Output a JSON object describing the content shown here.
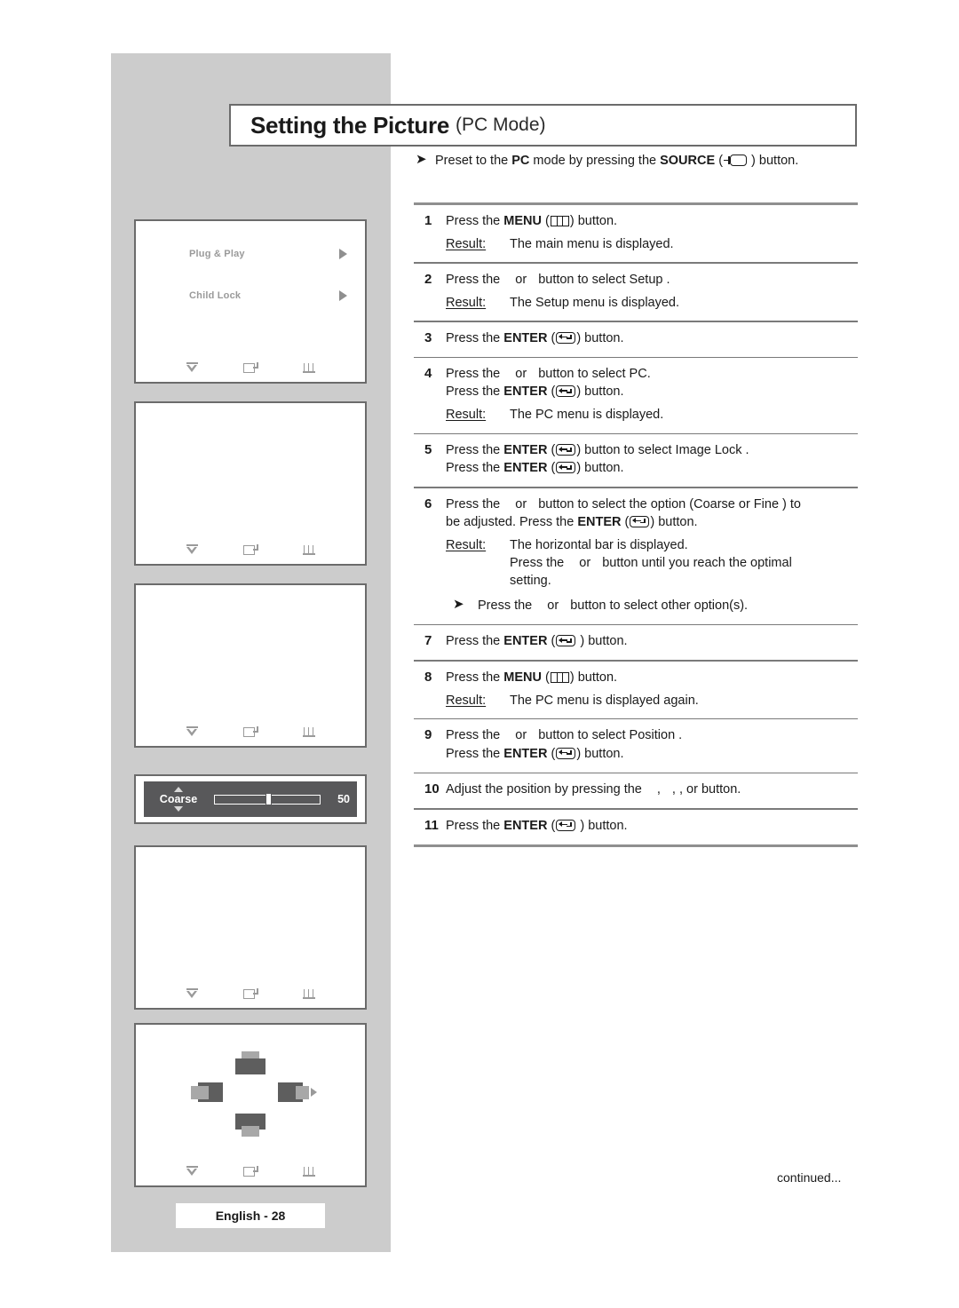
{
  "page": {
    "title_main": "Setting the Picture",
    "title_sub": "(PC Mode)",
    "continued_label": "continued...",
    "footer_label": "English - 28"
  },
  "intro": {
    "text_before_pc": "Preset to the ",
    "pc": "PC",
    "text_mid": " mode by pressing the ",
    "source": "SOURCE",
    "text_after": " ) button.",
    "open_paren": "(",
    "icon": "source-key-icon"
  },
  "steps": [
    {
      "num": "1",
      "lines": [
        {
          "pre": "Press the ",
          "bold": "MENU",
          "paren_open": "(",
          "icon": "menu-key-icon",
          "post": ") button."
        }
      ],
      "result": {
        "label": "Result:",
        "text": "The main menu is displayed."
      }
    },
    {
      "num": "2",
      "lines": [
        {
          "pre": "Press the ",
          "bold": "",
          "icon": "",
          "post": "or",
          "tail": "button to select Setup ."
        }
      ],
      "result": {
        "label": "Result:",
        "text": "The Setup  menu is displayed."
      }
    },
    {
      "num": "3",
      "lines": [
        {
          "pre": "Press the ",
          "bold": "ENTER",
          "paren_open": "(",
          "icon": "enter-key-icon",
          "post": ") button."
        }
      ],
      "result": null
    },
    {
      "num": "4",
      "lines": [
        {
          "pre": "Press the ",
          "post": "or",
          "tail": "button to select PC."
        },
        {
          "pre": "Press the ",
          "bold": "ENTER",
          "paren_open": "(",
          "icon": "enter-key-icon",
          "post": ") button."
        }
      ],
      "result": {
        "label": "Result:",
        "text": "The PC  menu is displayed."
      }
    },
    {
      "num": "5",
      "lines": [
        {
          "pre": "Press the ",
          "bold": "ENTER",
          "paren_open": "(",
          "icon": "enter-key-icon",
          "post": ") button to select Image Lock  ."
        },
        {
          "pre": "Press the ",
          "bold": "ENTER",
          "paren_open": "(",
          "icon": "enter-key-icon",
          "post": ") button."
        }
      ],
      "result": null
    },
    {
      "num": "6",
      "lines": [
        {
          "pre": "Press the ",
          "post": "or",
          "tail": "button to select the option (Coarse  or Fine ) to"
        },
        {
          "pre": "be adjusted. Press the ",
          "bold": "ENTER",
          "paren_open": "(",
          "icon": "enter-key-icon",
          "post": ") button."
        }
      ],
      "result": {
        "label": "Result:",
        "text": "The horizontal bar is displayed.",
        "extra_pre": "Press the ",
        "extra_or": "or",
        "extra_tail": "button until you reach the optimal",
        "extra_line2": "setting."
      },
      "sub_bullet": {
        "pre": "Press the ",
        "or": "or",
        "tail": "button to select other option(s)."
      }
    },
    {
      "num": "7",
      "lines": [
        {
          "pre": "Press the ",
          "bold": "ENTER",
          "paren_open": "(",
          "icon": "enter-key-icon",
          "post": " ) button."
        }
      ],
      "result": null
    },
    {
      "num": "8",
      "lines": [
        {
          "pre": "Press the ",
          "bold": "MENU",
          "paren_open": "(",
          "icon": "menu-key-icon",
          "post": ") button."
        }
      ],
      "result": {
        "label": "Result:",
        "text": "The PC  menu is displayed again."
      }
    },
    {
      "num": "9",
      "lines": [
        {
          "pre": "Press the ",
          "post": "or",
          "tail": "button to select Position  ."
        },
        {
          "pre": "Press the ",
          "bold": "ENTER",
          "paren_open": "(",
          "icon": "enter-key-icon",
          "post": ") button."
        }
      ],
      "result": null
    },
    {
      "num": "10",
      "lines": [
        {
          "pre": "Adjust the position by pressing the ",
          "post": ",",
          "tail": ",    , or     button."
        }
      ],
      "result": null
    },
    {
      "num": "11",
      "lines": [
        {
          "pre": "Press the ",
          "bold": "ENTER",
          "paren_open": "(",
          "icon": "enter-key-icon",
          "post": " ) button."
        }
      ],
      "result": null
    }
  ],
  "tv_panels": {
    "panel1": {
      "menu_items": [
        {
          "label": "Plug & Play",
          "caret": "caret-right-icon"
        },
        {
          "label": "Child Lock",
          "caret": "caret-right-icon"
        }
      ]
    },
    "nav_icons": [
      "move-icon",
      "enter-icon",
      "return-icon"
    ]
  },
  "slider": {
    "label": "Coarse",
    "value": "50",
    "position_percent": 48,
    "up_icon": "triangle-up-icon",
    "down_icon": "triangle-down-icon"
  },
  "position_panel": {
    "icons": [
      "shift-up-icon",
      "shift-down-icon",
      "shift-left-icon",
      "shift-right-icon"
    ]
  },
  "colors": {
    "backdrop": "#cccccc",
    "panel_border": "#6b6b6b",
    "osd_background": "#58585a",
    "menu_text": "#9a9a9a"
  }
}
